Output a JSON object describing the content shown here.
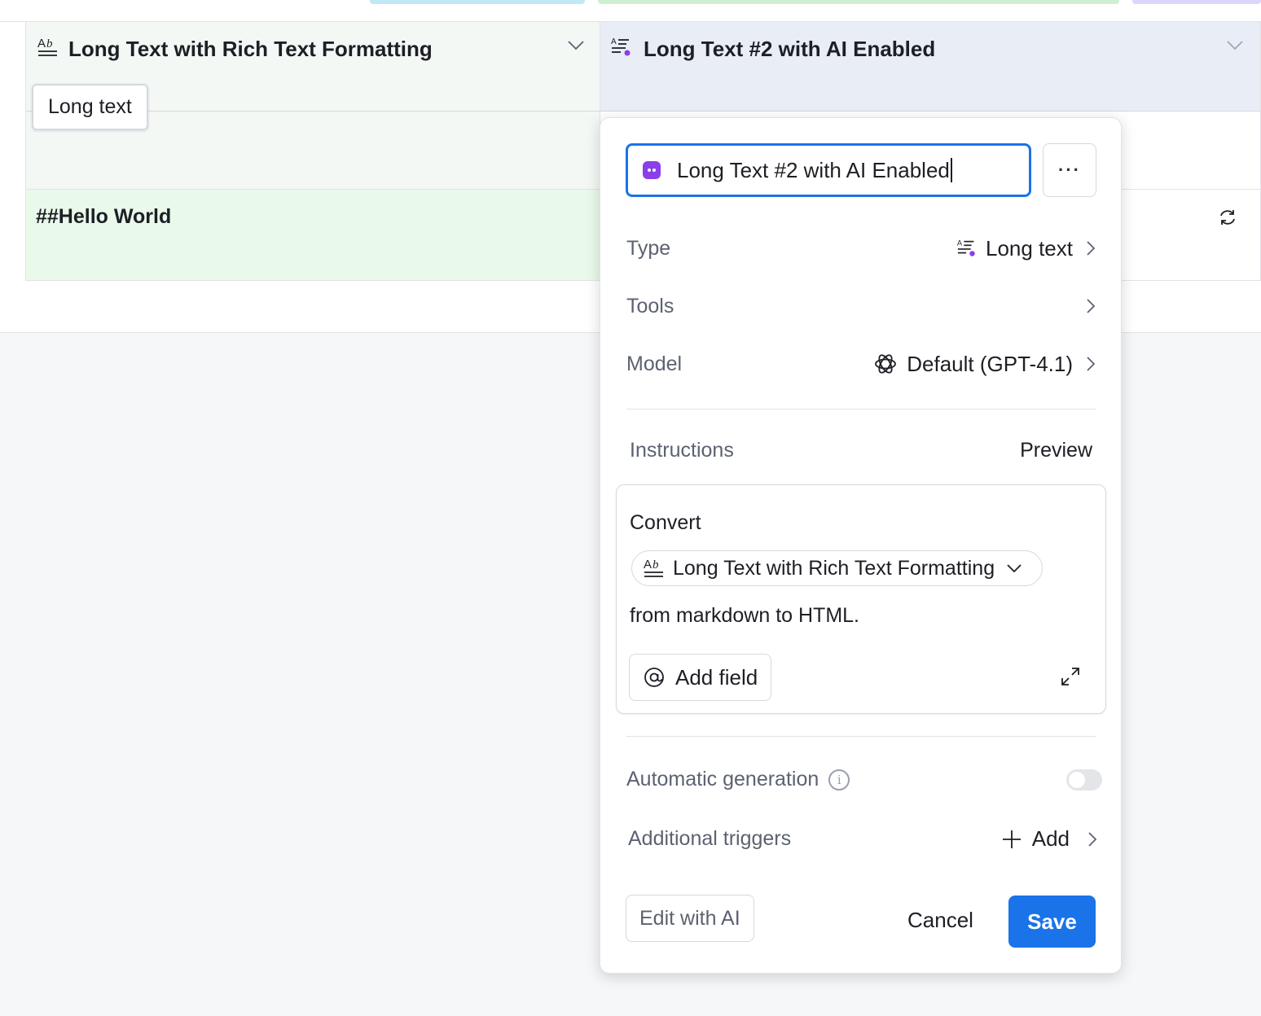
{
  "grid": {
    "columns": [
      {
        "name": "Long Text with Rich Text Formatting",
        "icon": "rich-text-icon"
      },
      {
        "name": "Long Text #2 with AI Enabled",
        "icon": "ai-long-text-icon"
      }
    ],
    "tooltip": "Long text",
    "rows": [
      {
        "col1": "",
        "col2": ""
      },
      {
        "col1": "##Hello World",
        "col2": ""
      }
    ]
  },
  "field_editor": {
    "name_value": "Long Text #2 with AI Enabled",
    "more_label": "···",
    "type": {
      "label": "Type",
      "value": "Long text",
      "icon": "ai-long-text-icon"
    },
    "tools": {
      "label": "Tools"
    },
    "model": {
      "label": "Model",
      "value": "Default (GPT-4.1)",
      "icon": "openai-icon"
    },
    "instructions": {
      "label": "Instructions",
      "preview_label": "Preview",
      "text_before": "Convert",
      "field_chip": "Long Text with Rich Text Formatting",
      "text_after": "from markdown to HTML.",
      "add_field_label": "Add field"
    },
    "automatic_generation": {
      "label": "Automatic generation",
      "enabled": false
    },
    "additional_triggers": {
      "label": "Additional triggers",
      "add_label": "Add"
    },
    "edit_with_ai_label": "Edit with AI",
    "cancel_label": "Cancel",
    "save_label": "Save"
  },
  "colors": {
    "accent": "#1a73e8",
    "ai_purple": "#8b3fe8",
    "col1_header_bg": "#f3f8f5",
    "col2_header_bg": "#e8edf6",
    "selected_cell_bg": "#e9f9ea"
  }
}
